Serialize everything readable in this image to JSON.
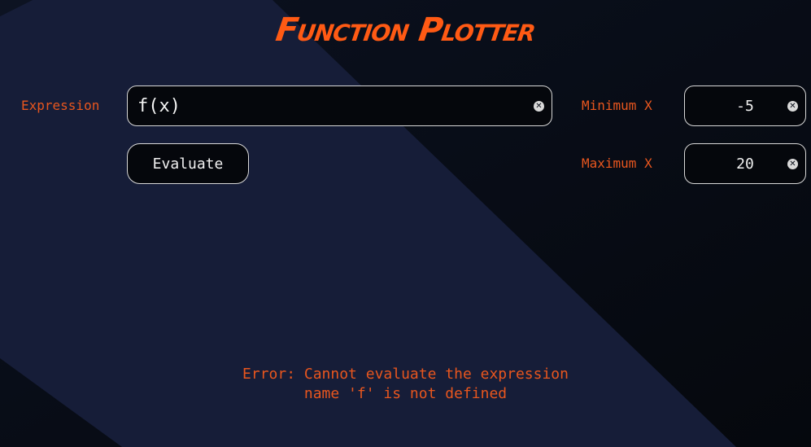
{
  "app": {
    "title": "Function Plotter"
  },
  "form": {
    "expression_label": "Expression",
    "expression_value": "f(x)",
    "evaluate_label": "Evaluate",
    "min_x_label": "Minimum X",
    "min_x_value": "-5",
    "max_x_label": "Maximum X",
    "max_x_value": "20"
  },
  "status": {
    "error_line1": "Error: Cannot evaluate the expression",
    "error_line2": "name 'f' is not defined"
  },
  "icons": {
    "clear": "clear-icon"
  },
  "colors": {
    "accent": "#ff5a14",
    "label": "#e8561e",
    "background": "#0a0e18",
    "stripe": "#161d38"
  }
}
